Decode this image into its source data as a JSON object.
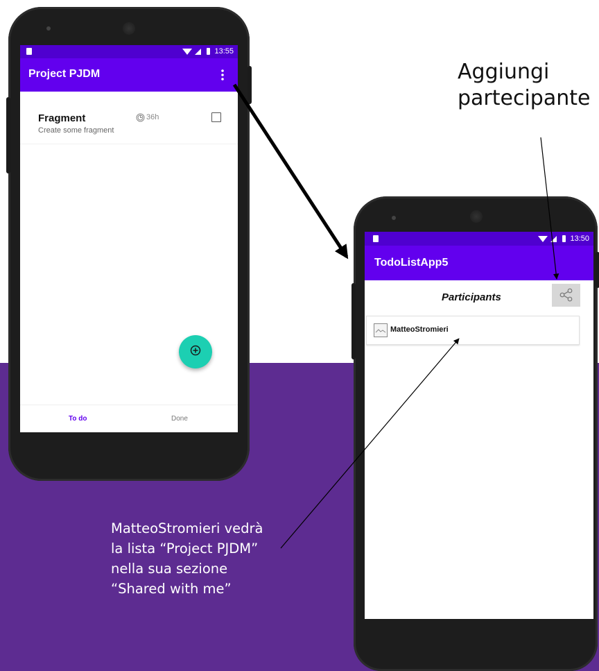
{
  "left_phone": {
    "status_time": "13:55",
    "app_title": "Project PJDM",
    "overflow_icon": "more-vert-icon",
    "task": {
      "title": "Fragment",
      "description": "Create some fragment",
      "duration": "36h",
      "duration_icon": "clock-icon",
      "checked": false
    },
    "fab_icon": "add-circle-icon",
    "tabs": [
      {
        "label": "To do",
        "active": true
      },
      {
        "label": "Done",
        "active": false
      }
    ]
  },
  "right_phone": {
    "status_time": "13:50",
    "app_title": "TodoListApp5",
    "section_title": "Participants",
    "share_icon": "share-icon",
    "participants": [
      {
        "name": "MatteoStromieri",
        "icon": "image-icon"
      }
    ]
  },
  "annotations": {
    "add_participant": [
      "Aggiungi",
      "partecipante"
    ],
    "note": [
      "MatteoStromieri vedrà",
      "la lista “Project PJDM”",
      "nella sua sezione",
      "“Shared with me”"
    ]
  },
  "colors": {
    "primary": "#6200ee",
    "status_bar": "#4f00cf",
    "fab": "#1ccfb2",
    "background_band": "#5d2c91"
  }
}
